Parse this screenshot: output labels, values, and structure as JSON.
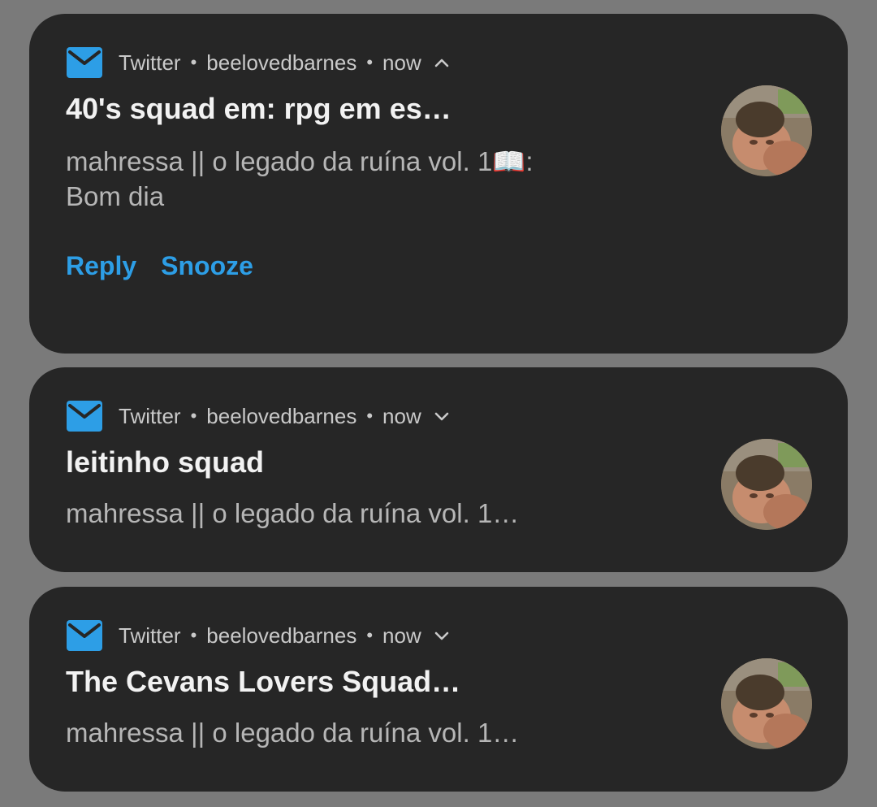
{
  "colors": {
    "background": "#7a7a7a",
    "card": "#262626",
    "accent": "#2d9ee6",
    "title_text": "#f2f2f2",
    "body_text": "#b6b6b6"
  },
  "notifications": [
    {
      "app": "Twitter",
      "account": "beelovedbarnes",
      "time": "now",
      "expanded": true,
      "chevron_icon": "chevron-up-icon",
      "title": "40's squad em: rpg em es…",
      "message_line1": "mahressa || o legado da ruína vol. 1📖:",
      "message_line2": "Bom dia",
      "actions": [
        "Reply",
        "Snooze"
      ]
    },
    {
      "app": "Twitter",
      "account": "beelovedbarnes",
      "time": "now",
      "expanded": false,
      "chevron_icon": "chevron-down-icon",
      "title": "leitinho squad",
      "message_line1": "mahressa || o legado da ruína vol. 1…"
    },
    {
      "app": "Twitter",
      "account": "beelovedbarnes",
      "time": "now",
      "expanded": false,
      "chevron_icon": "chevron-down-icon",
      "title": "The Cevans Lovers Squad…",
      "message_line1": "mahressa || o legado da ruína vol. 1…"
    }
  ]
}
